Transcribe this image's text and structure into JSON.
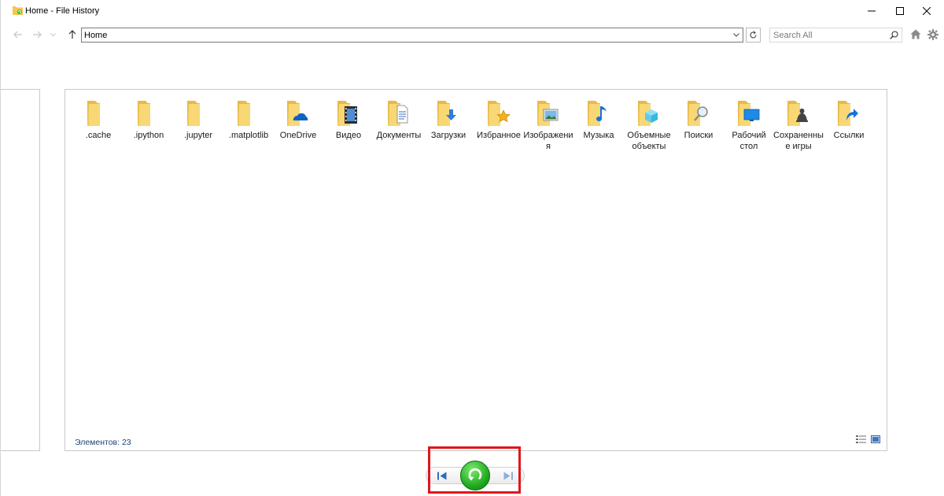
{
  "window": {
    "title": "Home - File History"
  },
  "navbar": {
    "address": "Home",
    "search_placeholder": "Search All"
  },
  "items": [
    {
      "label": ".cache",
      "icon": "folder-icon"
    },
    {
      "label": ".ipython",
      "icon": "folder-icon"
    },
    {
      "label": ".jupyter",
      "icon": "folder-icon"
    },
    {
      "label": ".matplotlib",
      "icon": "folder-icon"
    },
    {
      "label": "OneDrive",
      "icon": "onedrive-folder-icon"
    },
    {
      "label": "Видео",
      "icon": "video-folder-icon"
    },
    {
      "label": "Документы",
      "icon": "documents-folder-icon"
    },
    {
      "label": "Загрузки",
      "icon": "downloads-folder-icon"
    },
    {
      "label": "Избранное",
      "icon": "favorites-folder-icon"
    },
    {
      "label": "Изображения",
      "icon": "pictures-folder-icon"
    },
    {
      "label": "Музыка",
      "icon": "music-folder-icon"
    },
    {
      "label": "Объемные объекты",
      "icon": "3d-objects-folder-icon"
    },
    {
      "label": "Поиски",
      "icon": "searches-folder-icon"
    },
    {
      "label": "Рабочий стол",
      "icon": "desktop-folder-icon"
    },
    {
      "label": "Сохраненные игры",
      "icon": "saved-games-folder-icon"
    },
    {
      "label": "Ссылки",
      "icon": "links-folder-icon"
    }
  ],
  "status": {
    "items_count": "Элементов: 23"
  },
  "colors": {
    "folder": "#f8d775",
    "folder_dark": "#e8b94a",
    "restore_green": "#1da71f",
    "highlight_red": "#e0161b",
    "status_text": "#1e3f78"
  }
}
